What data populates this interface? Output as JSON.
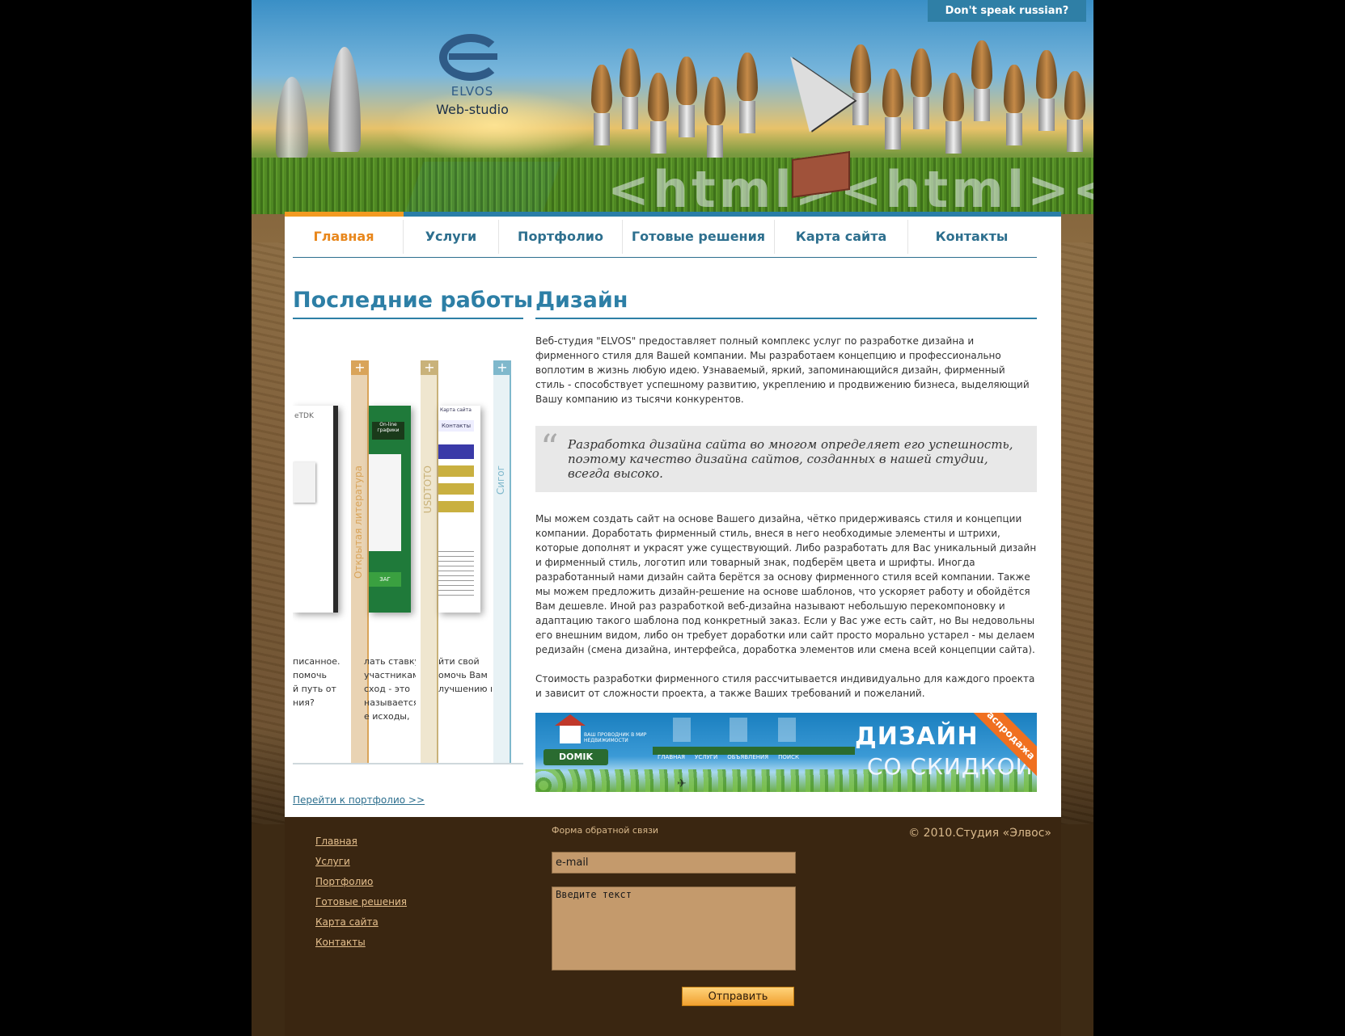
{
  "header": {
    "brand": "ELVOS",
    "subtitle": "Web-studio",
    "lang_button": "Don't speak russian?",
    "decor_text": "<html><html><h"
  },
  "nav": {
    "items": [
      {
        "label": "Главная",
        "active": true
      },
      {
        "label": "Услуги",
        "active": false
      },
      {
        "label": "Портфолио",
        "active": false
      },
      {
        "label": "Готовые решения",
        "active": false
      },
      {
        "label": "Карта сайта",
        "active": false
      },
      {
        "label": "Контакты",
        "active": false
      }
    ]
  },
  "latest": {
    "title": "Последние работы",
    "panels": [
      {
        "label": "Открытая литература",
        "color": "#d9a45a"
      },
      {
        "label": "USDTOTO",
        "color": "#c9b27a"
      },
      {
        "label": "Cигог",
        "color": "#7fb8cc"
      }
    ],
    "text_col1": [
      "писанное.",
      "помочь",
      "й путь от",
      "",
      "ния?"
    ],
    "text_col2": [
      "лать ставку",
      "участникам",
      "сход - это",
      "называется",
      "е исходы,"
    ],
    "text_col3": [
      "йти   свой",
      "омочь  Вам",
      "лучшению  и",
      "",
      ""
    ],
    "shot_labels": {
      "s1_logo": "eTDK",
      "s2_tag": "On-line графики",
      "s2_btn": "ЗАГ",
      "s3_title": "Карта сайта",
      "s3_btn": "Контакты"
    },
    "portfolio_link": "Перейти к портфолио >>"
  },
  "design": {
    "title": "Дизайн",
    "intro": "Веб-студия \"ELVOS\" предоставляет полный комплекс услуг по разработке дизайна и фирменного стиля для Вашей компании. Мы разработаем концепцию и профессионально воплотим в жизнь любую идею. Узнаваемый, яркий, запоминающийся дизайн, фирменный стиль - способствует успешному развитию, укреплению и продвижению бизнеса, выделяющий Вашу компанию из тысячи конкурентов.",
    "quote": "Разработка дизайна сайта во многом определяет его успешность, поэтому качество дизайна сайтов, созданных в нашей студии, всегда высоко.",
    "body": "Мы можем создать сайт на основе Вашего дизайна, чётко придерживаясь стиля и концепции компании. Доработать фирменный стиль, внеся в него необходимые элементы и штрихи, которые дополнят и украсят уже существующий. Либо разработать для Вас уникальный дизайн и фирменный стиль, логотип или товарный знак, подберём цвета и шрифты. Иногда разработанный нами дизайн сайта берётся за основу фирменного стиля всей компании. Также мы можем предложить дизайн-решение на основе шаблонов, что ускоряет работу и обойдётся Вам дешевле. Иной раз разработкой веб-дизайна называют небольшую перекомпоновку и адаптацию такого шаблона под конкретный заказ. Если у Вас уже есть сайт, но Вы недовольны его внешним видом, либо он требует доработки или сайт просто морально устарел - мы делаем редизайн (смена дизайна, интерфейса, доработка элементов или смена всей концепции сайта).",
    "cost": "Стоимость разработки фирменного стиля рассчитывается индивидуально для каждого проекта и зависит от сложности проекта, а также Ваших требований и пожеланий.",
    "banner": {
      "title1": "ДИЗАЙН",
      "title2": "СО СКИДКОЙ",
      "ribbon": "Распродажа",
      "logo": "DOMIK",
      "tagline": "ВАШ ПРОВОДНИК В МИР НЕДВИЖИМОСТИ",
      "nav": [
        "ГЛАВНАЯ",
        "УСЛУГИ",
        "ОБЪЯВЛЕНИЯ",
        "ПОИСК"
      ]
    }
  },
  "footer": {
    "links": [
      "Главная",
      "Услуги",
      "Портфолио",
      "Готовые решения",
      "Карта сайта",
      "Контакты"
    ],
    "form_title": "Форма обратной связи",
    "email_value": "e-mail",
    "message_value": "Введите текст",
    "send_label": "Отправить",
    "copyright": "© 2010.Студия «Элвос»"
  },
  "colors": {
    "accent": "#2d7fa6",
    "active": "#e8871c",
    "footer_bg": "#3a2611",
    "footer_link": "#e6c08e"
  }
}
